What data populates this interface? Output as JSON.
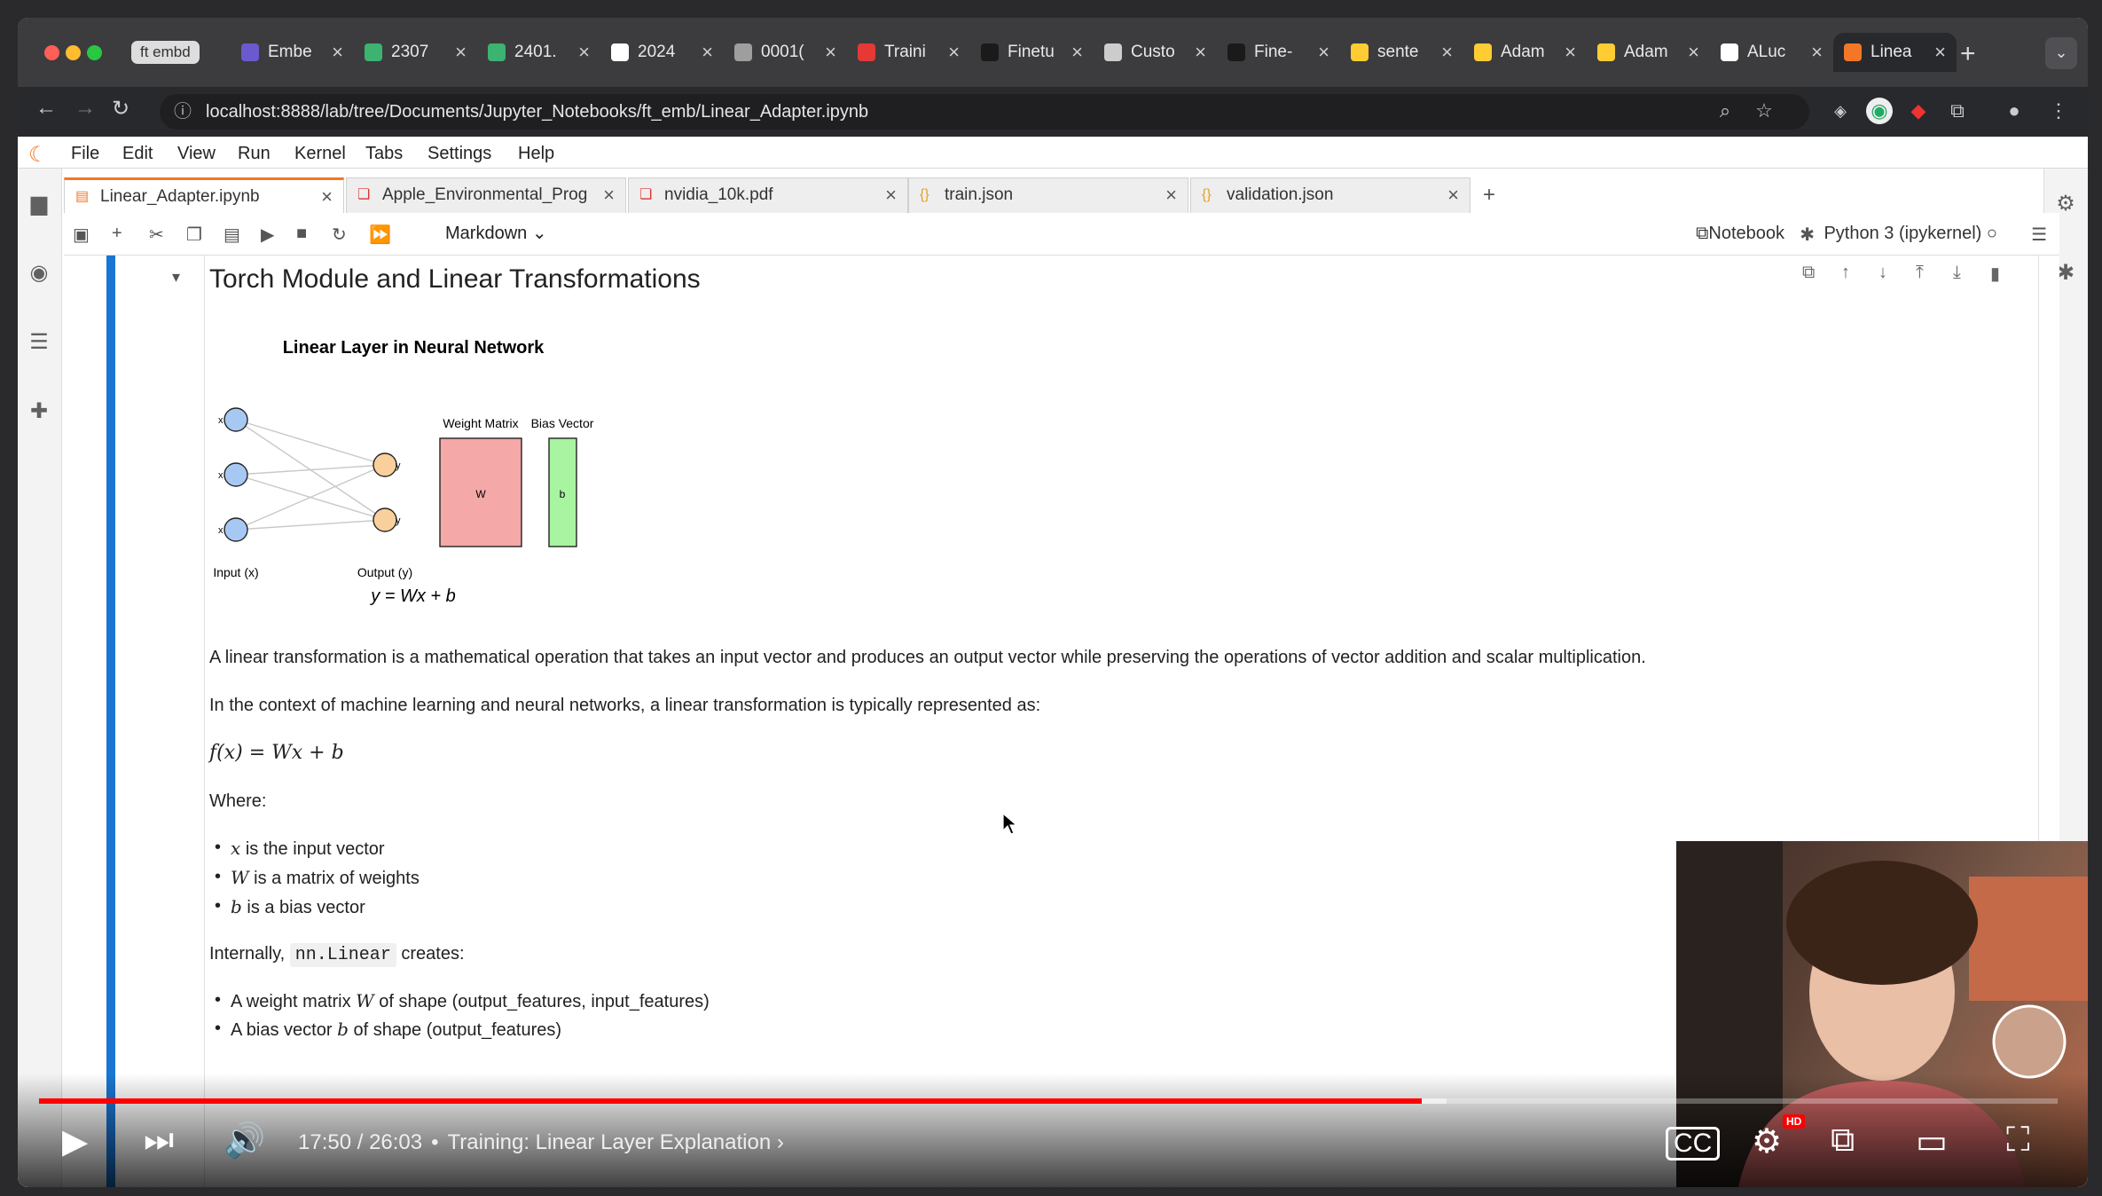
{
  "browser": {
    "tab_group_label": "ft embd",
    "tabs": [
      {
        "label": "Embe",
        "color": "#6a5acd"
      },
      {
        "label": "2307",
        "color": "#3cb371"
      },
      {
        "label": "2401.",
        "color": "#3cb371"
      },
      {
        "label": "2024",
        "color": "#ffffff"
      },
      {
        "label": "0001(",
        "color": "#9e9e9e"
      },
      {
        "label": "Traini",
        "color": "#e53935"
      },
      {
        "label": "Finetu",
        "color": "#1a1a1a"
      },
      {
        "label": "Custo",
        "color": "#cccccc"
      },
      {
        "label": "Fine-",
        "color": "#1a1a1a"
      },
      {
        "label": "sente",
        "color": "#ffcc33"
      },
      {
        "label": "Adam",
        "color": "#ffcc33"
      },
      {
        "label": "Adam",
        "color": "#ffcc33"
      },
      {
        "label": "ALuc",
        "color": "#ffffff"
      },
      {
        "label": "Linea",
        "color": "#f37726"
      }
    ],
    "url": "localhost:8888/lab/tree/Documents/Jupyter_Notebooks/ft_emb/Linear_Adapter.ipynb"
  },
  "jupyter": {
    "menus": [
      "File",
      "Edit",
      "View",
      "Run",
      "Kernel",
      "Tabs",
      "Settings",
      "Help"
    ],
    "doc_tabs": [
      {
        "label": "Linear_Adapter.ipynb",
        "icon": "notebook-icon"
      },
      {
        "label": "Apple_Environmental_Prog",
        "icon": "pdf-icon"
      },
      {
        "label": "nvidia_10k.pdf",
        "icon": "pdf-icon"
      },
      {
        "label": "train.json",
        "icon": "json-icon"
      },
      {
        "label": "validation.json",
        "icon": "json-icon"
      }
    ],
    "cell_type": "Markdown",
    "notebook_button": "Notebook",
    "kernel": "Python 3 (ipykernel)"
  },
  "cell": {
    "heading": "Torch Module and Linear Transformations",
    "figure": {
      "title": "Linear Layer in Neural Network",
      "weight_label": "Weight Matrix",
      "bias_label": "Bias Vector",
      "w_text": "W",
      "b_text": "b",
      "input_label": "Input (x)",
      "output_label": "Output (y)",
      "equation": "y = Wx + b",
      "x_node_label": "x",
      "y_node_label": "y"
    },
    "para1": "A linear transformation is a mathematical operation that takes an input vector and produces an output vector while preserving the operations of vector addition and scalar multiplication.",
    "para2": "In the context of machine learning and neural networks, a linear transformation is typically represented as:",
    "formula": "f(x) = Wx + b",
    "where": "Where:",
    "bullets": [
      {
        "sym": "x",
        "text": "is the input vector"
      },
      {
        "sym": "W",
        "text": "is a matrix of weights"
      },
      {
        "sym": "b",
        "text": "is a bias vector"
      }
    ],
    "internally_prefix": "Internally,",
    "internally_code": "nn.Linear",
    "internally_suffix": "creates:",
    "bullets2": [
      {
        "prefix": "A weight matrix",
        "sym": "W",
        "text": "of shape (output_features, input_features)"
      },
      {
        "prefix": "A bias vector",
        "sym": "b",
        "text": "of shape (output_features)"
      }
    ]
  },
  "video": {
    "time": "17:50 / 26:03",
    "chapter": "Training: Linear Layer Explanation",
    "progress": 0.6849,
    "buffered": 0.6973,
    "hd_badge": "HD"
  },
  "colors": {
    "jupyter_accent": "#f37726",
    "cell_active": "#1976d2",
    "x_node": "#a8c8f4",
    "y_node": "#f9d09c",
    "weight_fill": "#f4a8a8",
    "bias_fill": "#a8f4a0"
  }
}
